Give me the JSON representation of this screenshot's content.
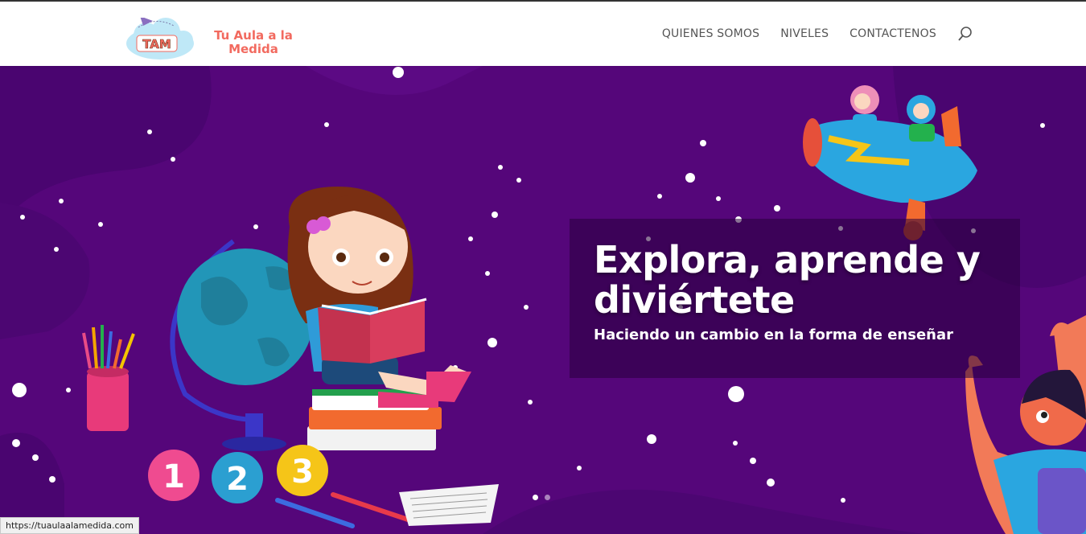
{
  "header": {
    "logo_badge": "TAM",
    "logo_text": "Tu Aula a la Medida",
    "nav": [
      {
        "label": "QUIENES SOMOS"
      },
      {
        "label": "NIVELES"
      },
      {
        "label": "CONTACTENOS"
      }
    ],
    "search_icon": "search-icon"
  },
  "hero": {
    "title": "Explora, aprende y diviértete",
    "subtitle": "Haciendo un cambio en la forma de enseñar",
    "background_color": "#55067a",
    "numbers": [
      "1",
      "2",
      "3"
    ],
    "slides": 2,
    "active_slide": 1
  },
  "statusbar": {
    "url": "https://tuaulaalamedida.com"
  },
  "colors": {
    "brand": "#f26a5f",
    "hero_bg": "#55067a"
  }
}
